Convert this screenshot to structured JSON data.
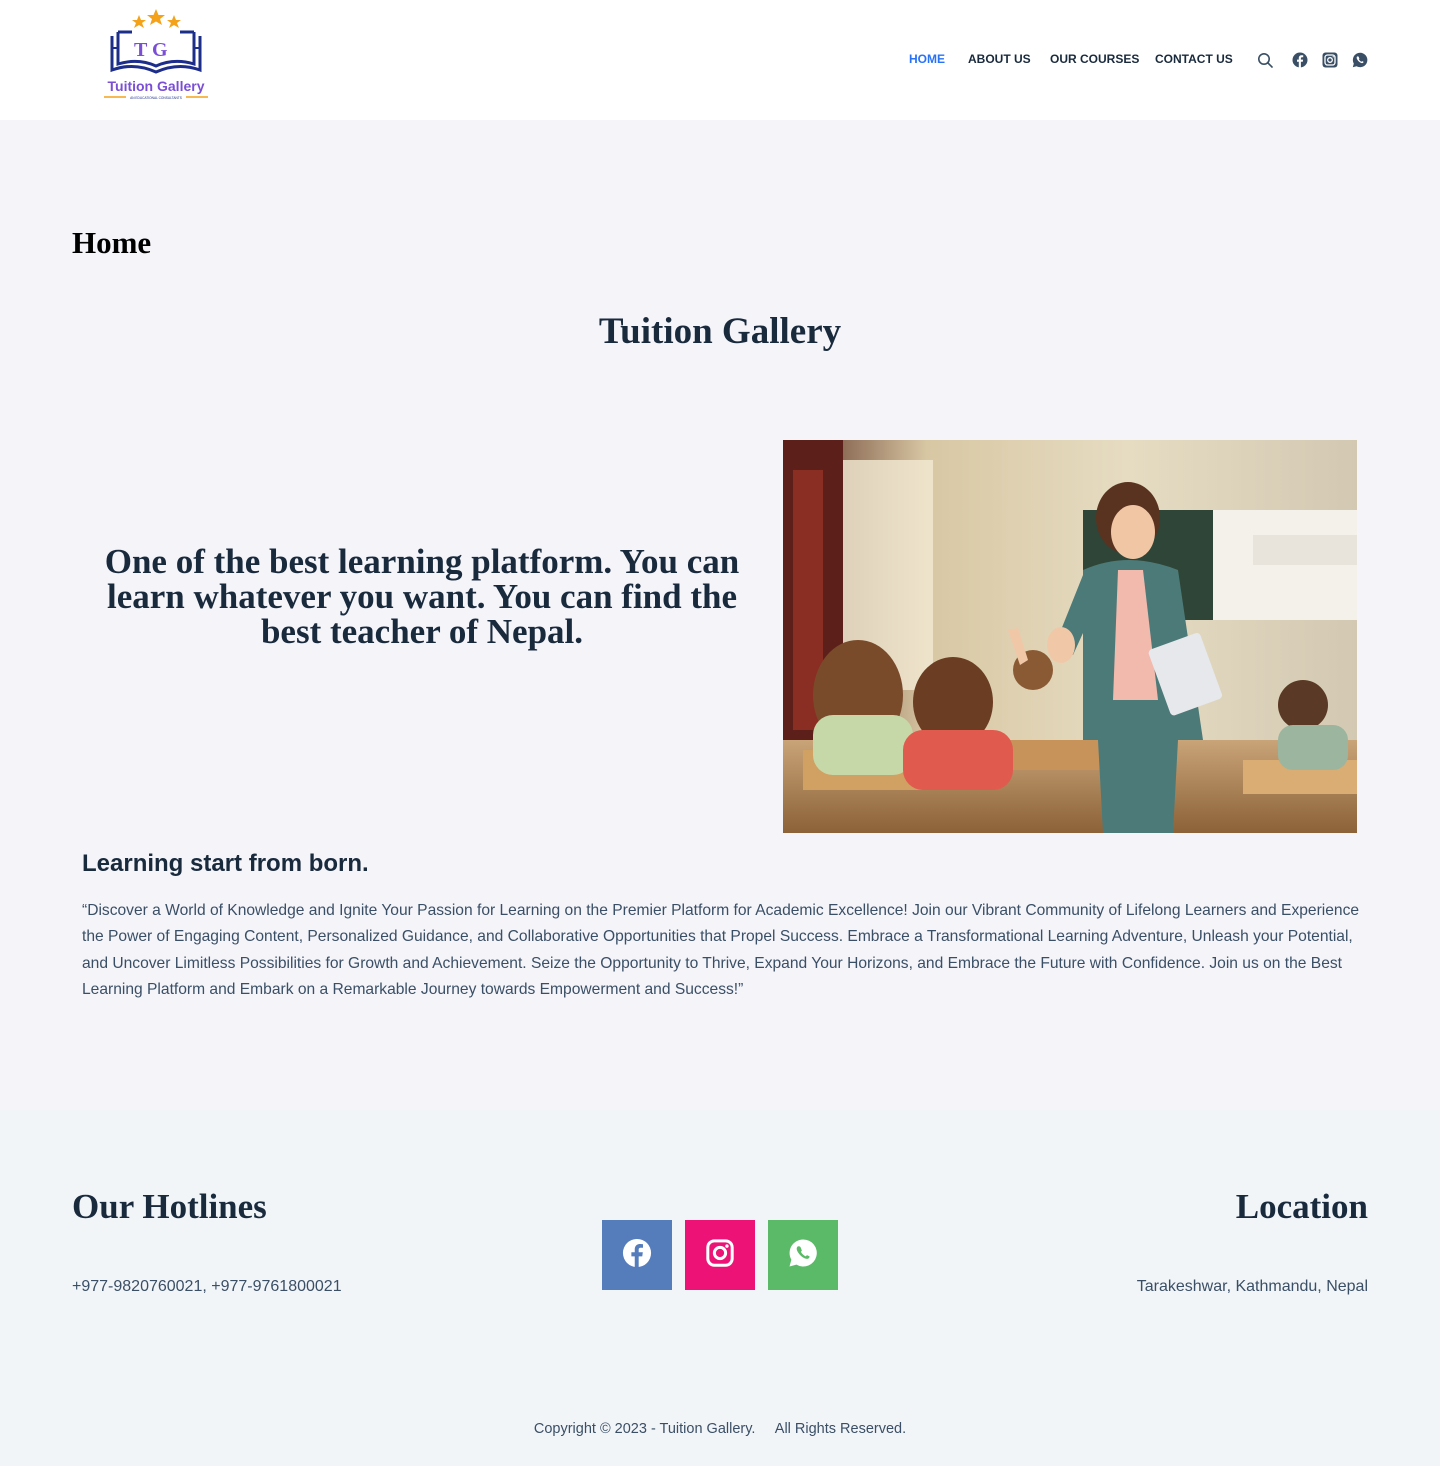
{
  "header": {
    "logo": {
      "initials": "T G",
      "name": "Tuition Gallery",
      "tagline": "AN EDUCATIONAL CONSULTANTS"
    },
    "nav": [
      {
        "label": "HOME",
        "active": true
      },
      {
        "label": "ABOUT US",
        "active": false
      },
      {
        "label": "OUR COURSES",
        "active": false
      },
      {
        "label": "CONTACT US",
        "active": false
      }
    ],
    "icons": [
      "search-icon",
      "facebook-icon",
      "instagram-icon",
      "whatsapp-icon"
    ]
  },
  "main": {
    "page_title": "Home",
    "site_title": "Tuition Gallery",
    "hero_text": "One of the best learning platform. You can learn whatever you want. You can find the best teacher of Nepal.",
    "hero_image": "classroom-teacher-high-five",
    "sub_heading": "Learning start from born.",
    "paragraph": "“Discover a World of Knowledge and Ignite Your Passion for Learning on the Premier Platform for Academic Excellence! Join our Vibrant Community of Lifelong Learners and Experience the Power of Engaging Content, Personalized Guidance, and Collaborative Opportunities that Propel Success. Embrace a Transformational Learning Adventure, Unleash your Potential, and Uncover Limitless Possibilities for Growth and Achievement. Seize the Opportunity to Thrive, Expand Your Horizons, and Embrace the Future with Confidence. Join us on the Best Learning Platform and Embark on a Remarkable Journey towards Empowerment and Success!”"
  },
  "footer": {
    "hotlines_heading": "Our Hotlines",
    "hotlines": "+977-9820760021, +977-9761800021",
    "location_heading": "Location",
    "location": "Tarakeshwar, Kathmandu, Nepal",
    "social": [
      {
        "name": "facebook-icon",
        "color": "#557dbc"
      },
      {
        "name": "instagram-icon",
        "color": "#ed1376"
      },
      {
        "name": "whatsapp-icon",
        "color": "#5bba67"
      }
    ],
    "copyright": "Copyright © 2023 - Tuition Gallery.     All Rights Reserved."
  },
  "colors": {
    "accent": "#2872fa",
    "heading": "#192a3d",
    "text": "#3a4f66",
    "background": "#f4f4f9",
    "logo_blue": "#1d2d8a",
    "logo_purple": "#7a4fd6",
    "logo_orange": "#f4a21a"
  }
}
